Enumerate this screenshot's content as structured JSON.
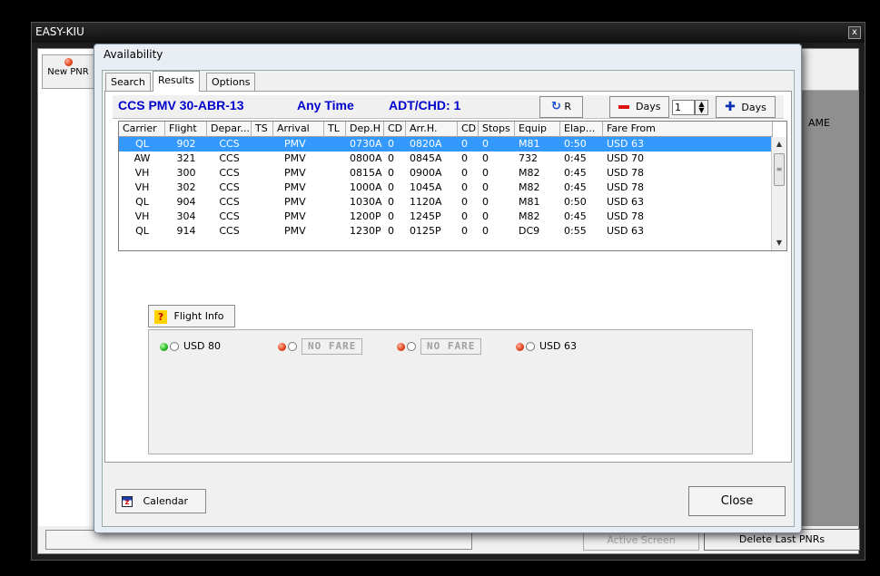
{
  "main_window": {
    "title": "EASY-KIU",
    "close_glyph": "x",
    "new_pnr_label": "New PNR",
    "name_label": "AME",
    "active_screen_label": "Active Screen",
    "delete_last_pnrs_label": "Delete Last PNRs"
  },
  "dialog": {
    "title": "Availability",
    "tabs": [
      {
        "label": "Search"
      },
      {
        "label": "Results"
      },
      {
        "label": "Options"
      }
    ],
    "header": {
      "route": "CCS PMV  30-ABR-13",
      "time": "Any Time",
      "pax": "ADT/CHD: 1",
      "refresh_label": "R",
      "minus_days_label": "Days",
      "days_value": "1",
      "plus_days_label": "Days"
    },
    "table": {
      "columns": [
        "Carrier",
        "Flight",
        "Depar...",
        "TS",
        "Arrival",
        "TL",
        "Dep.H",
        "CD",
        "Arr.H.",
        "CD",
        "Stops",
        "Equip",
        "Elap...",
        "Fare From"
      ],
      "rows": [
        [
          "QL",
          "902",
          "CCS",
          "",
          "PMV",
          "",
          "0730A",
          "0",
          "0820A",
          "0",
          "0",
          "M81",
          "0:50",
          "USD 63"
        ],
        [
          "AW",
          "321",
          "CCS",
          "",
          "PMV",
          "",
          "0800A",
          "0",
          "0845A",
          "0",
          "0",
          "732",
          "0:45",
          "USD 70"
        ],
        [
          "VH",
          "300",
          "CCS",
          "",
          "PMV",
          "",
          "0815A",
          "0",
          "0900A",
          "0",
          "0",
          "M82",
          "0:45",
          "USD 78"
        ],
        [
          "VH",
          "302",
          "CCS",
          "",
          "PMV",
          "",
          "1000A",
          "0",
          "1045A",
          "0",
          "0",
          "M82",
          "0:45",
          "USD 78"
        ],
        [
          "QL",
          "904",
          "CCS",
          "",
          "PMV",
          "",
          "1030A",
          "0",
          "1120A",
          "0",
          "0",
          "M81",
          "0:50",
          "USD 63"
        ],
        [
          "VH",
          "304",
          "CCS",
          "",
          "PMV",
          "",
          "1200P",
          "0",
          "1245P",
          "0",
          "0",
          "M82",
          "0:45",
          "USD 78"
        ],
        [
          "QL",
          "914",
          "CCS",
          "",
          "PMV",
          "",
          "1230P",
          "0",
          "0125P",
          "0",
          "0",
          "DC9",
          "0:55",
          "USD 63"
        ]
      ],
      "selected_row": 0
    },
    "flight_info_label": "Flight Info",
    "fares": [
      {
        "label": "USD 80",
        "status": "available",
        "dot_color": "#1fb51a"
      },
      {
        "label": "NO FARE",
        "status": "none",
        "dot_color": "#e0401a"
      },
      {
        "label": "NO FARE",
        "status": "none",
        "dot_color": "#e0401a"
      },
      {
        "label": "USD 63",
        "status": "available",
        "dot_color": "#e0401a"
      }
    ],
    "calendar_label": "Calendar",
    "close_label": "Close"
  }
}
